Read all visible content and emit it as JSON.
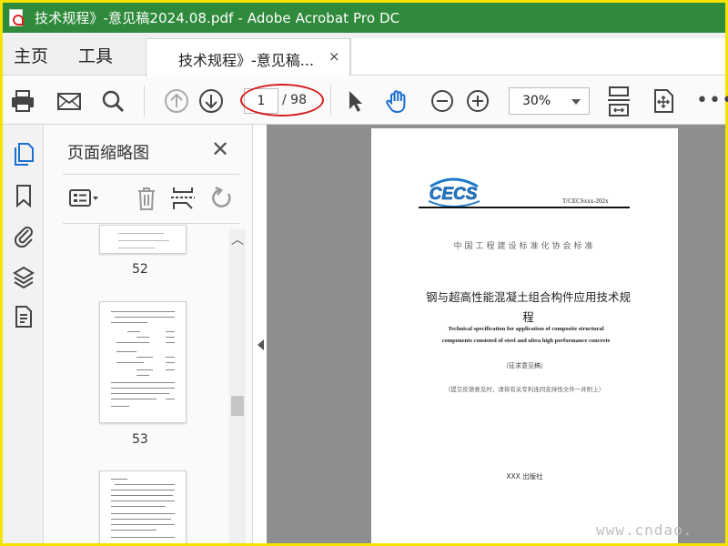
{
  "window": {
    "title": "技术规程》-意见稿2024.08.pdf - Adobe Acrobat Pro DC",
    "icon": "pdf-document-icon",
    "titlebar_color": "#2f8a3c"
  },
  "nav": {
    "home": "主页",
    "tools": "工具"
  },
  "tab": {
    "label": "技术规程》-意见稿...",
    "close": "×"
  },
  "toolbar": {
    "icons": [
      "print-icon",
      "email-icon",
      "search-icon",
      "prev-page-icon",
      "next-page-icon",
      "select-cursor-icon",
      "hand-tool-icon",
      "zoom-out-icon",
      "zoom-in-icon",
      "scroll-mode-icon",
      "fit-page-icon",
      "more-icon"
    ],
    "current_page": "1",
    "total_pages": "/ 98",
    "zoom": "30%",
    "more": "•••",
    "annotation_color": "#d71d1d"
  },
  "rail": {
    "icons": [
      "page-thumbnails-icon",
      "bookmark-icon",
      "attachment-icon",
      "layers-icon",
      "document-icon"
    ]
  },
  "thumbnails_panel": {
    "title": "页面缩略图",
    "close": "✕",
    "tools": [
      "page-options-icon",
      "delete-icon",
      "insert-page-icon",
      "rotate-icon"
    ],
    "pages": [
      {
        "number": "52"
      },
      {
        "number": "53"
      },
      {
        "number": ""
      }
    ]
  },
  "document": {
    "logo_text": "CECS",
    "standard_no": "T/CECSxxx-202x",
    "association": "中国工程建设标准化协会标准",
    "title_cn_line1": "钢与超高性能混凝土组合构件应用技术规",
    "title_cn_line2": "程",
    "title_en_line1": "Technical specification for application of composite structural",
    "title_en_line2": "components consisted of steel and ultra high performance concrete",
    "draft_label": "（征求意见稿）",
    "note": "（提交反馈意见时，请将有关专利连同支持性文件一并附上）",
    "publisher": "XXX 出版社"
  },
  "watermark": "www.cndao."
}
